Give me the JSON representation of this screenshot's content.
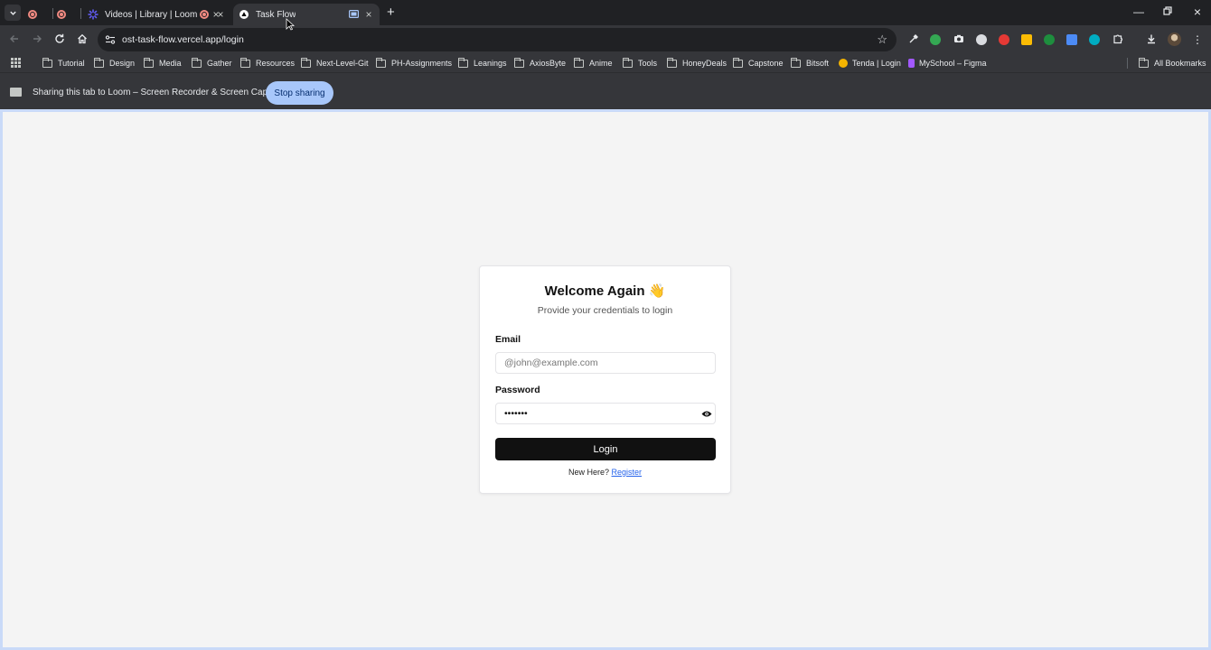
{
  "browser": {
    "tabs": [
      {
        "label": "",
        "icon": "loom-record-icon"
      },
      {
        "label": "",
        "icon": "loom-record-icon"
      },
      {
        "label": "Videos | Library | Loom",
        "icon": "loom-icon"
      },
      {
        "label": "",
        "icon": "loom-record-icon"
      },
      {
        "label": "Task Flow",
        "icon": "vercel-triangle-icon",
        "active": true
      }
    ],
    "url": "ost-task-flow.vercel.app/login"
  },
  "bookmarks": [
    {
      "label": "Tutorial",
      "type": "folder"
    },
    {
      "label": "Design",
      "type": "folder"
    },
    {
      "label": "Media",
      "type": "folder"
    },
    {
      "label": "Gather",
      "type": "folder"
    },
    {
      "label": "Resources",
      "type": "folder"
    },
    {
      "label": "Next-Level-Git",
      "type": "folder"
    },
    {
      "label": "PH-Assignments",
      "type": "folder"
    },
    {
      "label": "Leanings",
      "type": "folder"
    },
    {
      "label": "AxiosByte",
      "type": "folder"
    },
    {
      "label": "Anime",
      "type": "folder"
    },
    {
      "label": "Tools",
      "type": "folder"
    },
    {
      "label": "HoneyDeals",
      "type": "folder"
    },
    {
      "label": "Capstone",
      "type": "folder"
    },
    {
      "label": "Bitsoft",
      "type": "folder"
    },
    {
      "label": "Tenda | Login",
      "type": "site",
      "color": "#f4b400"
    },
    {
      "label": "MySchool – Figma",
      "type": "site",
      "color": "#a259ff"
    },
    {
      "label": "All Bookmarks",
      "type": "folder"
    }
  ],
  "sharing": {
    "message": "Sharing this tab to Loom – Screen Recorder & Screen Capture",
    "stop_label": "Stop sharing"
  },
  "login": {
    "title": "Welcome Again",
    "title_emoji": "👋",
    "subtitle": "Provide your credentials to login",
    "email_label": "Email",
    "email_placeholder": "@john@example.com",
    "password_label": "Password",
    "password_value": "•••••••",
    "submit_label": "Login",
    "register_prompt": "New Here?",
    "register_link": "Register"
  },
  "colors": {
    "accent_button": "#111111",
    "link": "#2563eb",
    "stop_sharing": "#a8c7fa",
    "page_bg": "#f4f4f4"
  }
}
